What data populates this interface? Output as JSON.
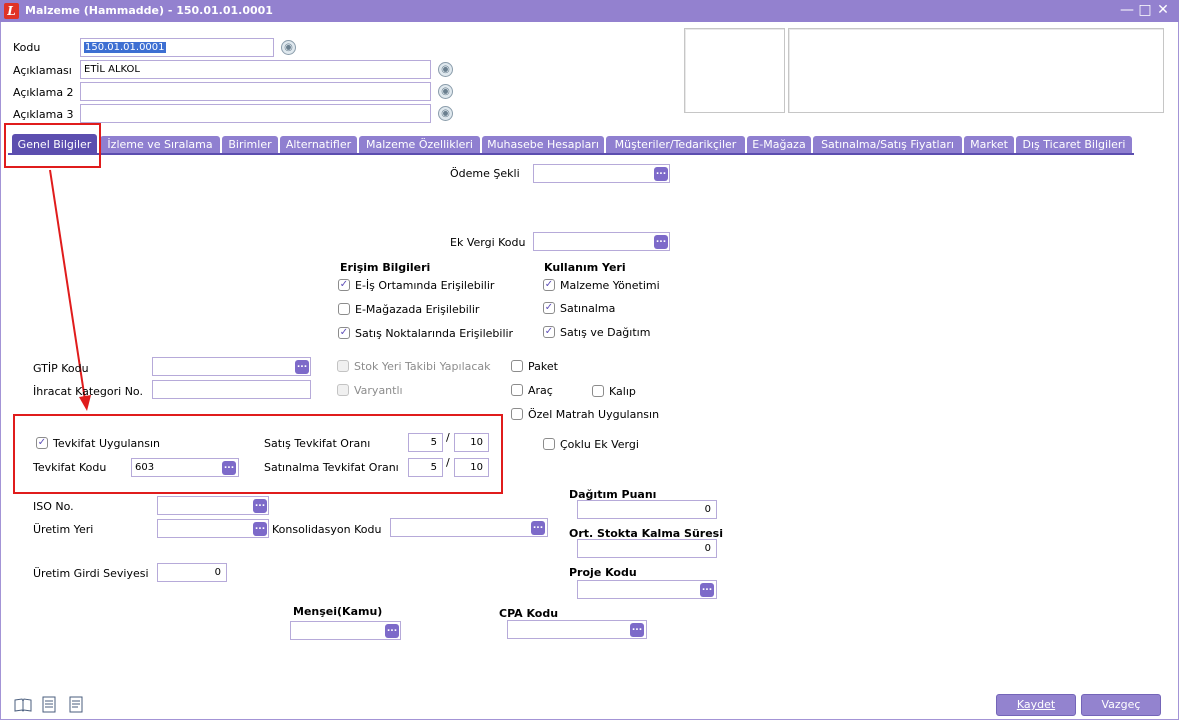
{
  "window": {
    "title": "Malzeme (Hammadde) - 150.01.01.0001",
    "app_icon": "L"
  },
  "header": {
    "kodu_label": "Kodu",
    "kodu_value": "150.01.01.0001",
    "aciklamasi_label": "Açıklaması",
    "aciklamasi_value": "ETİL ALKOL",
    "aciklama2_label": "Açıklama 2",
    "aciklama2_value": "",
    "aciklama3_label": "Açıklama 3",
    "aciklama3_value": ""
  },
  "tabs": [
    "Genel Bilgiler",
    "İzleme ve Sıralama",
    "Birimler",
    "Alternatifler",
    "Malzeme Özellikleri",
    "Muhasebe Hesapları",
    "Müşteriler/Tedarikçiler",
    "E-Mağaza",
    "Satınalma/Satış Fiyatları",
    "Market",
    "Dış Ticaret Bilgileri"
  ],
  "general": {
    "odeme_sekli_label": "Ödeme Şekli",
    "ek_vergi_kodu_label": "Ek Vergi Kodu",
    "erisim_title": "Erişim Bilgileri",
    "erisim": [
      "E-İş Ortamında Erişilebilir",
      "E-Mağazada Erişilebilir",
      "Satış Noktalarında Erişilebilir"
    ],
    "kullanim_title": "Kullanım Yeri",
    "kullanim": [
      "Malzeme Yönetimi",
      "Satınalma",
      "Satış ve Dağıtım"
    ],
    "gtip_label": "GTİP Kodu",
    "ihracat_label": "İhracat Kategori No.",
    "stok_yeri_label": "Stok Yeri Takibi Yapılacak",
    "varyantli_label": "Varyantlı",
    "paket_label": "Paket",
    "arac_label": "Araç",
    "kalip_label": "Kalıp",
    "ozel_matrah_label": "Özel Matrah Uygulansın",
    "tevkifat_label": "Tevkifat Uygulansın",
    "tevkifat_kodu_label": "Tevkifat Kodu",
    "tevkifat_kodu_value": "603",
    "satis_tevkifat_label": "Satış Tevkifat Oranı",
    "satis_tevkifat_num": "5",
    "satis_tevkifat_den": "10",
    "satinalma_tevkifat_label": "Satınalma Tevkifat Oranı",
    "satinalma_tevkifat_num": "5",
    "satinalma_tevkifat_den": "10",
    "slash": "/",
    "coklu_ek_vergi_label": "Çoklu Ek Vergi",
    "iso_label": "ISO No.",
    "uretim_yeri_label": "Üretim Yeri",
    "konsolidasyon_label": "Konsolidasyon Kodu",
    "uretim_girdi_label": "Üretim Girdi Seviyesi",
    "uretim_girdi_value": "0",
    "dagitim_puani_label": "Dağıtım Puanı",
    "dagitim_puani_value": "0",
    "ort_stokta_label": "Ort. Stokta Kalma Süresi",
    "ort_stokta_value": "0",
    "proje_kodu_label": "Proje Kodu",
    "mensei_label": "Menşei(Kamu)",
    "cpa_label": "CPA Kodu",
    "lookup_glyph": "..."
  },
  "buttons": {
    "kaydet": "Kaydet",
    "vazgec": "Vazgeç"
  },
  "colors": {
    "titlebar": "#9381cf",
    "accent": "#5c4eaf",
    "highlight": "#e01c1c"
  }
}
